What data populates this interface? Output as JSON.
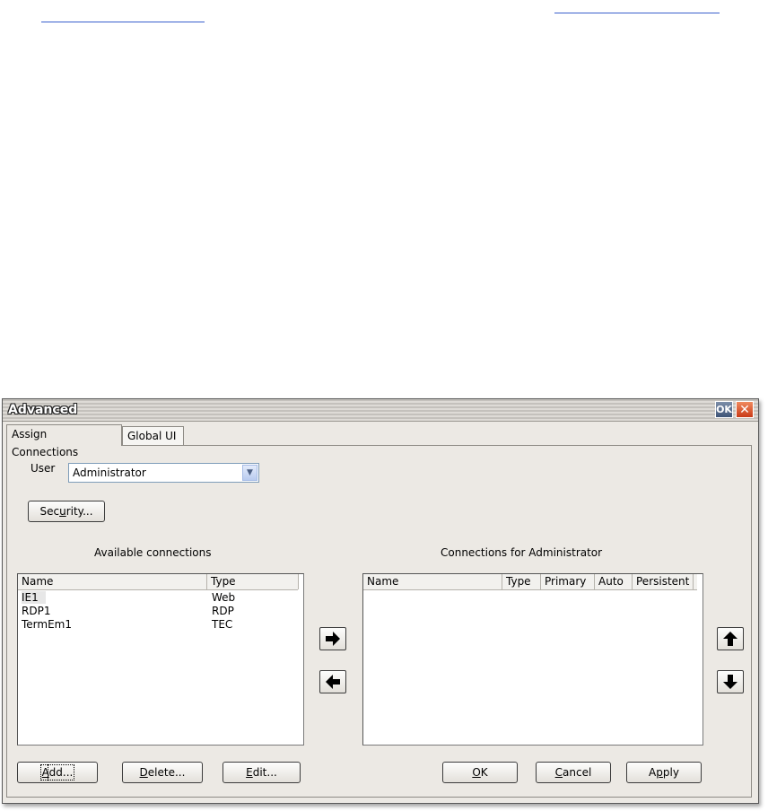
{
  "window": {
    "title": "Advanced",
    "ok_label": "OK",
    "close_glyph": "✕"
  },
  "tabs": [
    {
      "label": "Assign Connections",
      "active": true
    },
    {
      "label": "Global UI",
      "active": false
    }
  ],
  "user": {
    "label": "User",
    "value": "Administrator"
  },
  "security_button": {
    "pre": "Sec",
    "mnemonic": "u",
    "post": "rity..."
  },
  "available": {
    "title": "Available connections",
    "columns": [
      "Name",
      "Type"
    ],
    "rows": [
      {
        "name": "IE1",
        "type": "Web"
      },
      {
        "name": "RDP1",
        "type": "RDP"
      },
      {
        "name": "TermEm1",
        "type": "TEC"
      }
    ]
  },
  "assigned": {
    "title": "Connections for Administrator",
    "columns": [
      "Name",
      "Type",
      "Primary",
      "Auto",
      "Persistent"
    ],
    "rows": []
  },
  "buttons": {
    "add": {
      "mnemonic": "A",
      "post": "dd..."
    },
    "delete": {
      "mnemonic": "D",
      "post": "elete..."
    },
    "edit": {
      "mnemonic": "E",
      "post": "dit..."
    },
    "ok": {
      "mnemonic": "O",
      "post": "K"
    },
    "cancel": {
      "mnemonic": "C",
      "post": "ancel"
    },
    "apply": {
      "pre": "A",
      "mnemonic": "p",
      "post": "ply"
    }
  },
  "icons": {
    "move_right": "arrow-right-icon",
    "move_left": "arrow-left-icon",
    "move_up": "arrow-up-icon",
    "move_down": "arrow-down-icon",
    "combo_arrow": "chevron-down-icon"
  },
  "colors": {
    "dialog_bg": "#ece9e4",
    "link_underline": "#3a5fcd",
    "close_button": "#c93b17"
  }
}
